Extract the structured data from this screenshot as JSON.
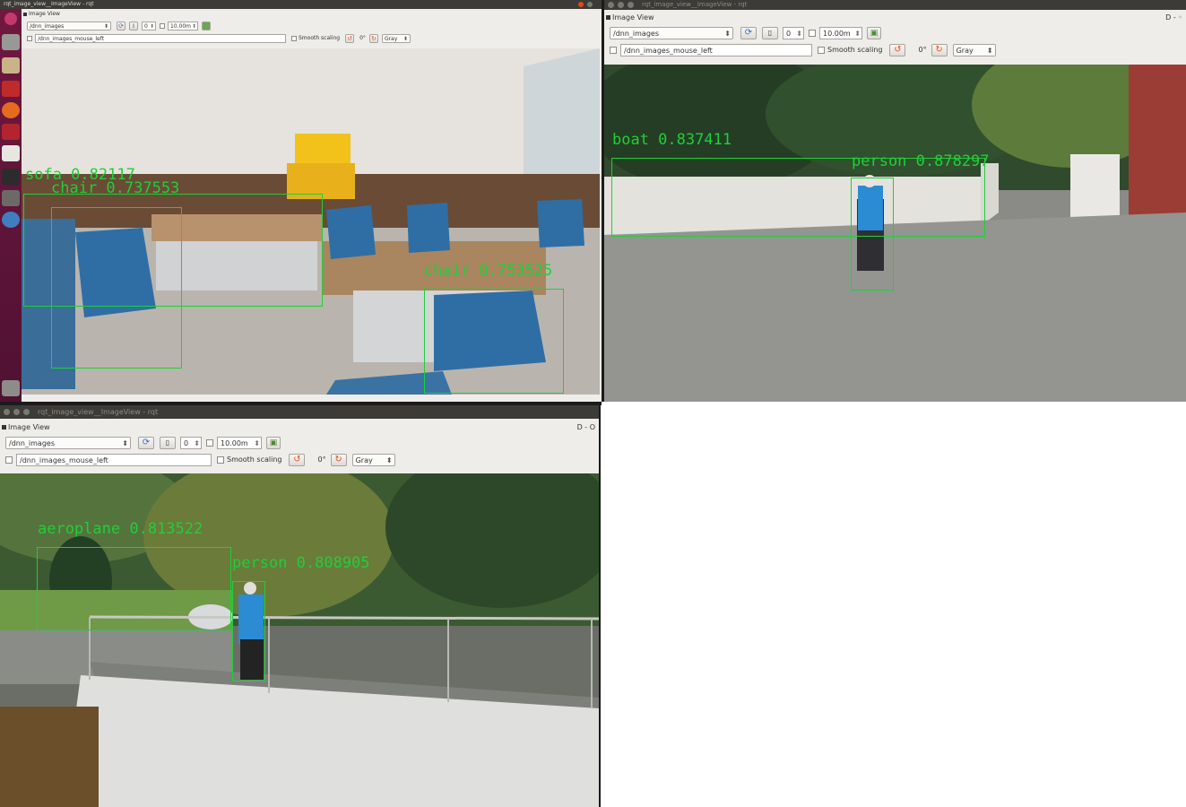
{
  "windows": [
    {
      "id": "win1",
      "title": "rqt_image_view__ImageView - rqt",
      "panel_title": "Image View",
      "topic": "/dnn_images",
      "spin_value": "0",
      "timeout": "10.00m",
      "mouse_topic": "/dnn_images_mouse_left",
      "smooth_label": "Smooth scaling",
      "rotation": "0°",
      "colormap": "Gray",
      "detections": [
        {
          "label": "sofa 0.82117"
        },
        {
          "label": "chair 0.737553"
        },
        {
          "label": "chair 0.753525"
        }
      ]
    },
    {
      "id": "win2",
      "title": "rqt_image_view__ImageView - rqt",
      "panel_title": "Image View",
      "panel_ctrl": "D - ◦",
      "topic": "/dnn_images",
      "spin_value": "0",
      "timeout": "10.00m",
      "mouse_topic": "/dnn_images_mouse_left",
      "smooth_label": "Smooth scaling",
      "rotation": "0°",
      "colormap": "Gray",
      "detections": [
        {
          "label": "boat 0.837411"
        },
        {
          "label": "person 0.878297"
        }
      ]
    },
    {
      "id": "win3",
      "title": "rqt_image_view__ImageView - rqt",
      "panel_title": "Image View",
      "panel_ctrl": "D - O",
      "topic": "/dnn_images",
      "spin_value": "0",
      "timeout": "10.00m",
      "mouse_topic": "/dnn_images_mouse_left",
      "smooth_label": "Smooth scaling",
      "rotation": "0°",
      "colormap": "Gray",
      "detections": [
        {
          "label": "aeroplane 0.813522"
        },
        {
          "label": "person 0.808905"
        }
      ]
    }
  ],
  "launcher": {
    "icons": [
      "ubuntu-dash-icon",
      "files-icon",
      "folder-icon",
      "terminal-red-icon",
      "firefox-icon",
      "app-red-icon",
      "text-editor-icon",
      "terminal-icon",
      "drive-icon",
      "globe-icon",
      "trash-icon"
    ]
  },
  "colors": {
    "detection": "#1fcf3a",
    "launcher": "#5e1338",
    "titlebar": "#3c3b37",
    "help_icon": "#2a6fd6"
  }
}
